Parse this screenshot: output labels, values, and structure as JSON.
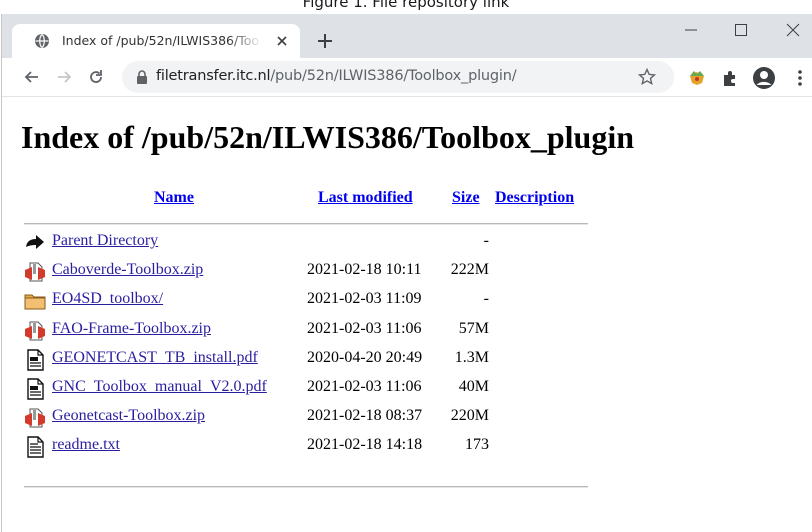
{
  "caption": "Figure 1. File repository link",
  "browser": {
    "tab_title": "Index of /pub/52n/ILWIS386/Toolbox_plugin",
    "url_host": "filetransfer.itc.nl",
    "url_path": "/pub/52n/ILWIS386/Toolbox_plugin/"
  },
  "page": {
    "heading": "Index of /pub/52n/ILWIS386/Toolbox_plugin",
    "columns": {
      "name": "Name",
      "last_modified": "Last modified",
      "size": "Size",
      "description": "Description"
    },
    "files": [
      {
        "name": "Parent Directory",
        "date": "",
        "size": "-",
        "icon": "back-arrow-icon"
      },
      {
        "name": "Caboverde-Toolbox.zip",
        "date": "2021-02-18 10:11",
        "size": "222M",
        "icon": "compressed-file-icon"
      },
      {
        "name": "EO4SD_toolbox/",
        "date": "2021-02-03 11:09",
        "size": "-",
        "icon": "folder-icon"
      },
      {
        "name": "FAO-Frame-Toolbox.zip",
        "date": "2021-02-03 11:06",
        "size": "57M",
        "icon": "compressed-file-icon"
      },
      {
        "name": "GEONETCAST_TB_install.pdf",
        "date": "2020-04-20 20:49",
        "size": "1.3M",
        "icon": "document-icon"
      },
      {
        "name": "GNC_Toolbox_manual_V2.0.pdf",
        "date": "2021-02-03 11:06",
        "size": "40M",
        "icon": "document-icon"
      },
      {
        "name": "Geonetcast-Toolbox.zip",
        "date": "2021-02-18 08:37",
        "size": "220M",
        "icon": "compressed-file-icon"
      },
      {
        "name": "readme.txt",
        "date": "2021-02-18 14:18",
        "size": "173",
        "icon": "text-file-icon"
      }
    ]
  },
  "colors": {
    "link": "#2a1ea0",
    "header_link": "#0000ee",
    "tabstrip": "#dee1e6",
    "omnibox": "#f1f3f4"
  }
}
